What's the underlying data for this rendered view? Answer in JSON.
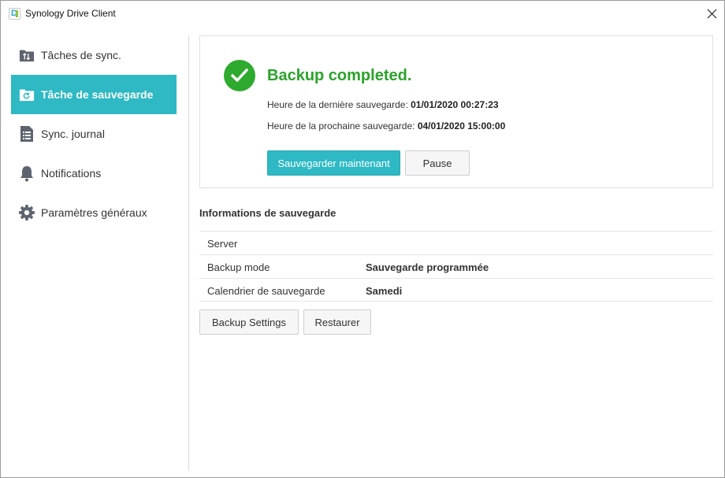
{
  "window": {
    "title": "Synology Drive Client",
    "logo_letter": "D"
  },
  "sidebar": {
    "items": [
      {
        "label": "Tâches de sync.",
        "icon": "sync-tasks-icon",
        "active": false
      },
      {
        "label": "Tâche de sauvegarde",
        "icon": "backup-folder-icon",
        "active": true
      },
      {
        "label": "Sync. journal",
        "icon": "journal-list-icon",
        "active": false
      },
      {
        "label": "Notifications",
        "icon": "bell-icon",
        "active": false
      },
      {
        "label": "Paramètres généraux",
        "icon": "gear-icon",
        "active": false
      }
    ]
  },
  "status": {
    "title": "Backup completed.",
    "last_backup_label": "Heure de la dernière sauvegarde:",
    "last_backup_value": "01/01/2020 00:27:23",
    "next_backup_label": "Heure de la prochaine sauvegarde:",
    "next_backup_value": "04/01/2020 15:00:00",
    "backup_now_label": "Sauvegarder maintenant",
    "pause_label": "Pause"
  },
  "info": {
    "section_title": "Informations de sauvegarde",
    "rows": [
      {
        "key": "Server",
        "value": ""
      },
      {
        "key": "Backup mode",
        "value": "Sauvegarde programmée"
      },
      {
        "key": "Calendrier de sauvegarde",
        "value": "Samedi"
      }
    ],
    "backup_settings_label": "Backup Settings",
    "restore_label": "Restaurer"
  },
  "colors": {
    "accent": "#2eb9c4",
    "success": "#2aa32a"
  }
}
